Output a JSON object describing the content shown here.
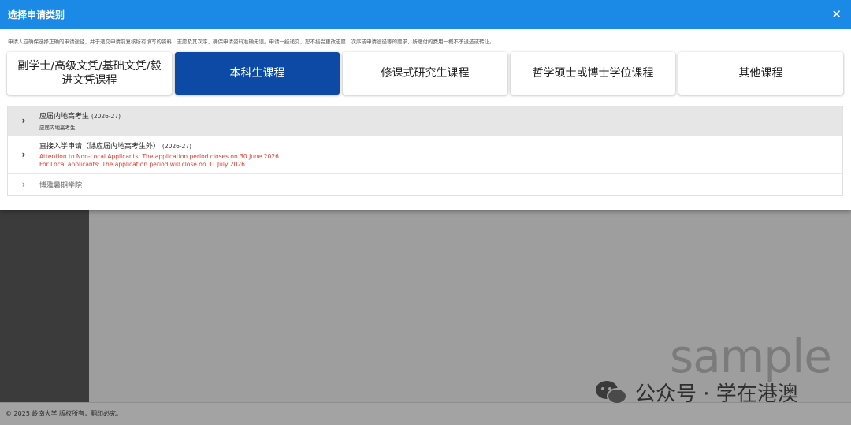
{
  "footer": {
    "copyright": "© 2025 岭南大学 版权所有，翻印必究。"
  },
  "watermark": {
    "sample": "sample",
    "wechat": "公众号 · 学在港澳"
  },
  "modal": {
    "title": "选择申请类别",
    "close_label": "✕",
    "notice": "申请人应确保选择正确的申请途径，并于递交申请前复核所有填写的资料、志愿及其次序，确保申请资料准确无误。申请一经递交，恕不接受更改志愿、次序或申请途径等的要求，所缴付的费用一概不予退还或转让。",
    "tiles": [
      {
        "label": "副学士/高级文凭/基础文凭/毅进文凭课程",
        "active": false
      },
      {
        "label": "本科生课程",
        "active": true
      },
      {
        "label": "修课式研究生课程",
        "active": false
      },
      {
        "label": "哲学硕士或博士学位课程",
        "active": false
      },
      {
        "label": "其他课程",
        "active": false
      }
    ],
    "items": [
      {
        "title": "应届内地高考生",
        "year": "(2026-27)",
        "subtitle": "应届内地高考生"
      },
      {
        "title": "直接入学申请（除应届内地高考生外）",
        "year": "(2026-27)",
        "warning1": "Attention to Non-Local Applicants: The application period closes on 30 June 2026",
        "warning2": "For Local applicants: The application period will close on 31 July 2026"
      },
      {
        "title": "博雅暑期学院"
      }
    ]
  },
  "icons": {
    "chevron": "›"
  },
  "colors": {
    "header_bg": "#1a8ae6",
    "active_tile": "#0c4aa6",
    "warning": "#e0382b"
  }
}
